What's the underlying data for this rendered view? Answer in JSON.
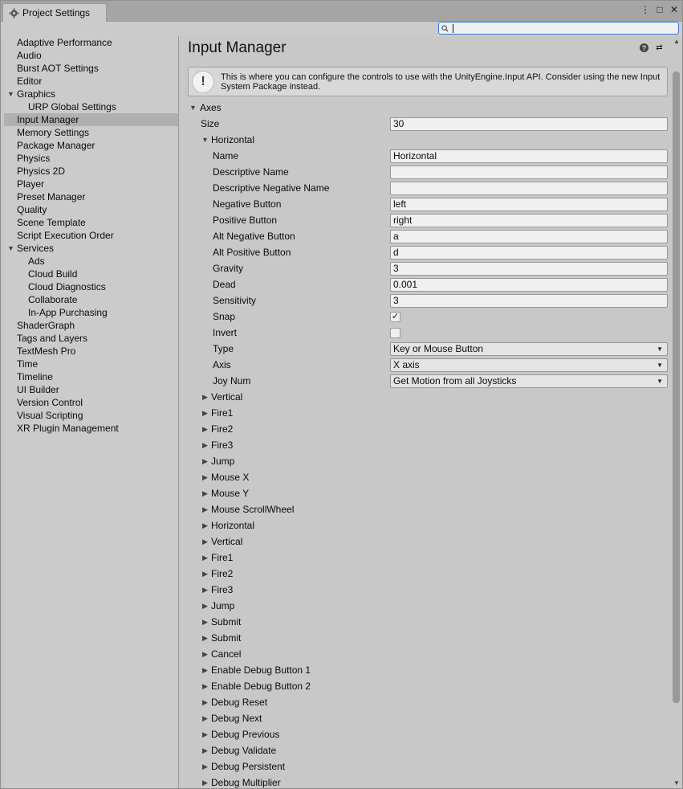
{
  "window": {
    "tab_title": "Project Settings",
    "buttons": [
      "⋮",
      "□",
      "✕"
    ]
  },
  "search": {
    "placeholder": "",
    "value": ""
  },
  "sidebar": {
    "items": [
      {
        "label": "Adaptive Performance",
        "level": 0
      },
      {
        "label": "Audio",
        "level": 0
      },
      {
        "label": "Burst AOT Settings",
        "level": 0
      },
      {
        "label": "Editor",
        "level": 0
      },
      {
        "label": "Graphics",
        "level": 0,
        "expanded": true
      },
      {
        "label": "URP Global Settings",
        "level": 1
      },
      {
        "label": "Input Manager",
        "level": 0,
        "selected": true
      },
      {
        "label": "Memory Settings",
        "level": 0
      },
      {
        "label": "Package Manager",
        "level": 0
      },
      {
        "label": "Physics",
        "level": 0
      },
      {
        "label": "Physics 2D",
        "level": 0
      },
      {
        "label": "Player",
        "level": 0
      },
      {
        "label": "Preset Manager",
        "level": 0
      },
      {
        "label": "Quality",
        "level": 0
      },
      {
        "label": "Scene Template",
        "level": 0
      },
      {
        "label": "Script Execution Order",
        "level": 0
      },
      {
        "label": "Services",
        "level": 0,
        "expanded": true
      },
      {
        "label": "Ads",
        "level": 1
      },
      {
        "label": "Cloud Build",
        "level": 1
      },
      {
        "label": "Cloud Diagnostics",
        "level": 1
      },
      {
        "label": "Collaborate",
        "level": 1
      },
      {
        "label": "In-App Purchasing",
        "level": 1
      },
      {
        "label": "ShaderGraph",
        "level": 0
      },
      {
        "label": "Tags and Layers",
        "level": 0
      },
      {
        "label": "TextMesh Pro",
        "level": 0
      },
      {
        "label": "Time",
        "level": 0
      },
      {
        "label": "Timeline",
        "level": 0
      },
      {
        "label": "UI Builder",
        "level": 0
      },
      {
        "label": "Version Control",
        "level": 0
      },
      {
        "label": "Visual Scripting",
        "level": 0
      },
      {
        "label": "XR Plugin Management",
        "level": 0
      }
    ]
  },
  "main": {
    "title": "Input Manager",
    "help_message": "This is where you can configure the controls to use with the UnityEngine.Input API. Consider using the new Input System Package instead.",
    "axes_label": "Axes",
    "size_label": "Size",
    "size_value": "30",
    "expanded_axis": "Horizontal",
    "properties": [
      {
        "label": "Name",
        "kind": "text",
        "value": "Horizontal"
      },
      {
        "label": "Descriptive Name",
        "kind": "text",
        "value": ""
      },
      {
        "label": "Descriptive Negative Name",
        "kind": "text",
        "value": ""
      },
      {
        "label": "Negative Button",
        "kind": "text",
        "value": "left"
      },
      {
        "label": "Positive Button",
        "kind": "text",
        "value": "right"
      },
      {
        "label": "Alt Negative Button",
        "kind": "text",
        "value": "a"
      },
      {
        "label": "Alt Positive Button",
        "kind": "text",
        "value": "d"
      },
      {
        "label": "Gravity",
        "kind": "text",
        "value": "3"
      },
      {
        "label": "Dead",
        "kind": "text",
        "value": "0.001"
      },
      {
        "label": "Sensitivity",
        "kind": "text",
        "value": "3"
      },
      {
        "label": "Snap",
        "kind": "check",
        "checked": true
      },
      {
        "label": "Invert",
        "kind": "check",
        "checked": false
      },
      {
        "label": "Type",
        "kind": "dropdown",
        "value": "Key or Mouse Button"
      },
      {
        "label": "Axis",
        "kind": "dropdown",
        "value": "X axis"
      },
      {
        "label": "Joy Num",
        "kind": "dropdown",
        "value": "Get Motion from all Joysticks"
      }
    ],
    "collapsed_axes": [
      "Vertical",
      "Fire1",
      "Fire2",
      "Fire3",
      "Jump",
      "Mouse X",
      "Mouse Y",
      "Mouse ScrollWheel",
      "Horizontal",
      "Vertical",
      "Fire1",
      "Fire2",
      "Fire3",
      "Jump",
      "Submit",
      "Submit",
      "Cancel",
      "Enable Debug Button 1",
      "Enable Debug Button 2",
      "Debug Reset",
      "Debug Next",
      "Debug Previous",
      "Debug Validate",
      "Debug Persistent",
      "Debug Multiplier"
    ]
  }
}
